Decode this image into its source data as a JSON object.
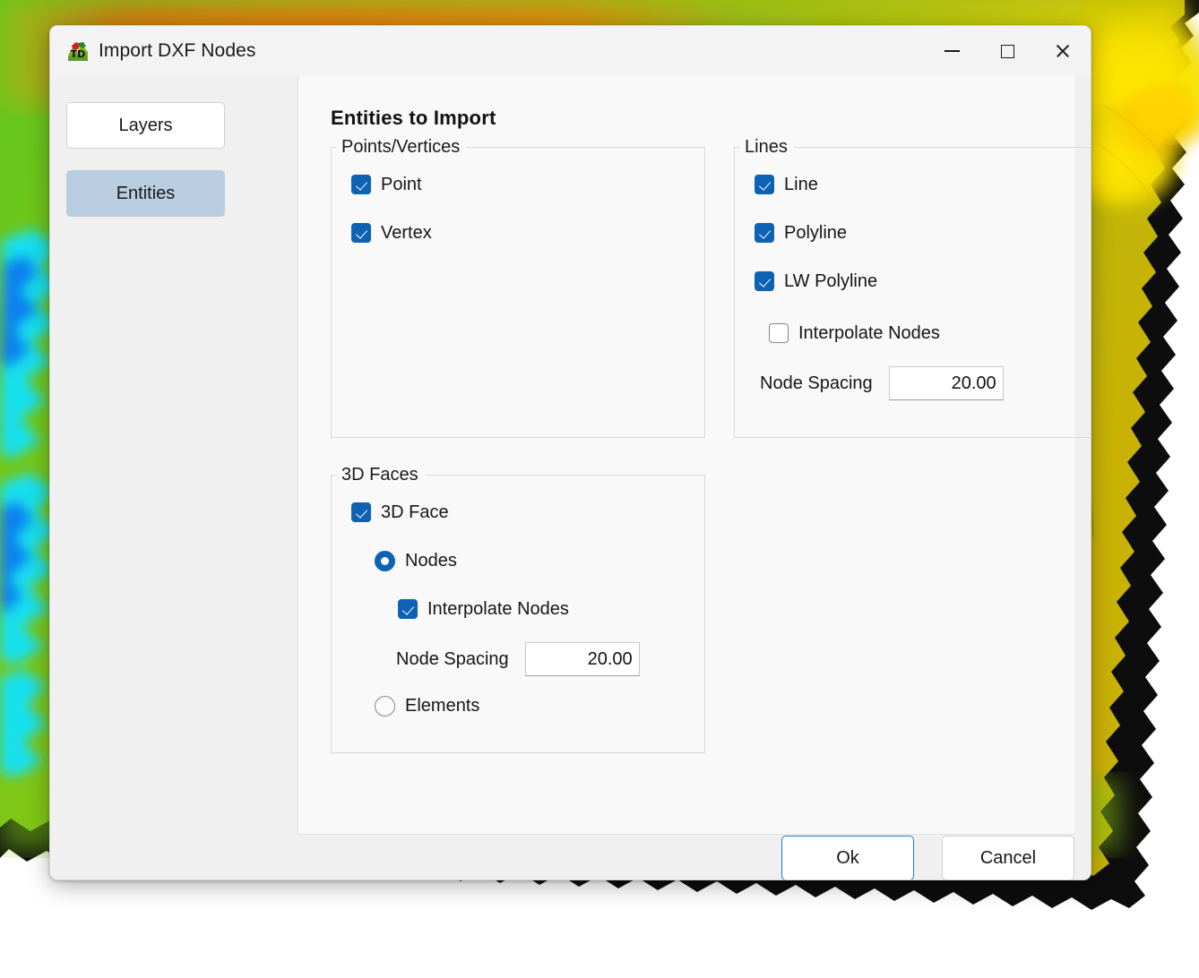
{
  "window": {
    "title": "Import DXF Nodes",
    "icon": "terrain-map-icon",
    "controls": {
      "minimize": "minimize-icon",
      "maximize": "maximize-icon",
      "close": "close-icon"
    }
  },
  "sidebar": {
    "items": [
      {
        "label": "Layers",
        "selected": false
      },
      {
        "label": "Entities",
        "selected": true
      }
    ]
  },
  "main": {
    "heading": "Entities to Import",
    "groups": {
      "points_vertices": {
        "legend": "Points/Vertices",
        "checkboxes": [
          {
            "label": "Point",
            "checked": true
          },
          {
            "label": "Vertex",
            "checked": true
          }
        ]
      },
      "lines": {
        "legend": "Lines",
        "checkboxes": [
          {
            "label": "Line",
            "checked": true
          },
          {
            "label": "Polyline",
            "checked": true
          },
          {
            "label": "LW Polyline",
            "checked": true
          }
        ],
        "interpolate": {
          "label": "Interpolate Nodes",
          "checked": false
        },
        "node_spacing": {
          "label": "Node Spacing",
          "value": "20.00"
        }
      },
      "faces_3d": {
        "legend": "3D Faces",
        "enable": {
          "label": "3D Face",
          "checked": true
        },
        "mode_options": [
          {
            "label": "Nodes",
            "selected": true
          },
          {
            "label": "Elements",
            "selected": false
          }
        ],
        "interpolate": {
          "label": "Interpolate Nodes",
          "checked": true
        },
        "node_spacing": {
          "label": "Node Spacing",
          "value": "20.00"
        }
      }
    }
  },
  "footer": {
    "ok_label": "Ok",
    "cancel_label": "Cancel"
  },
  "colors": {
    "accent": "#0d62b4",
    "selected_nav": "#b9cde0",
    "focus_border": "#1e7ad1",
    "dialog_bg": "#f0f0f0",
    "panel_bg": "#f9f9f9"
  }
}
